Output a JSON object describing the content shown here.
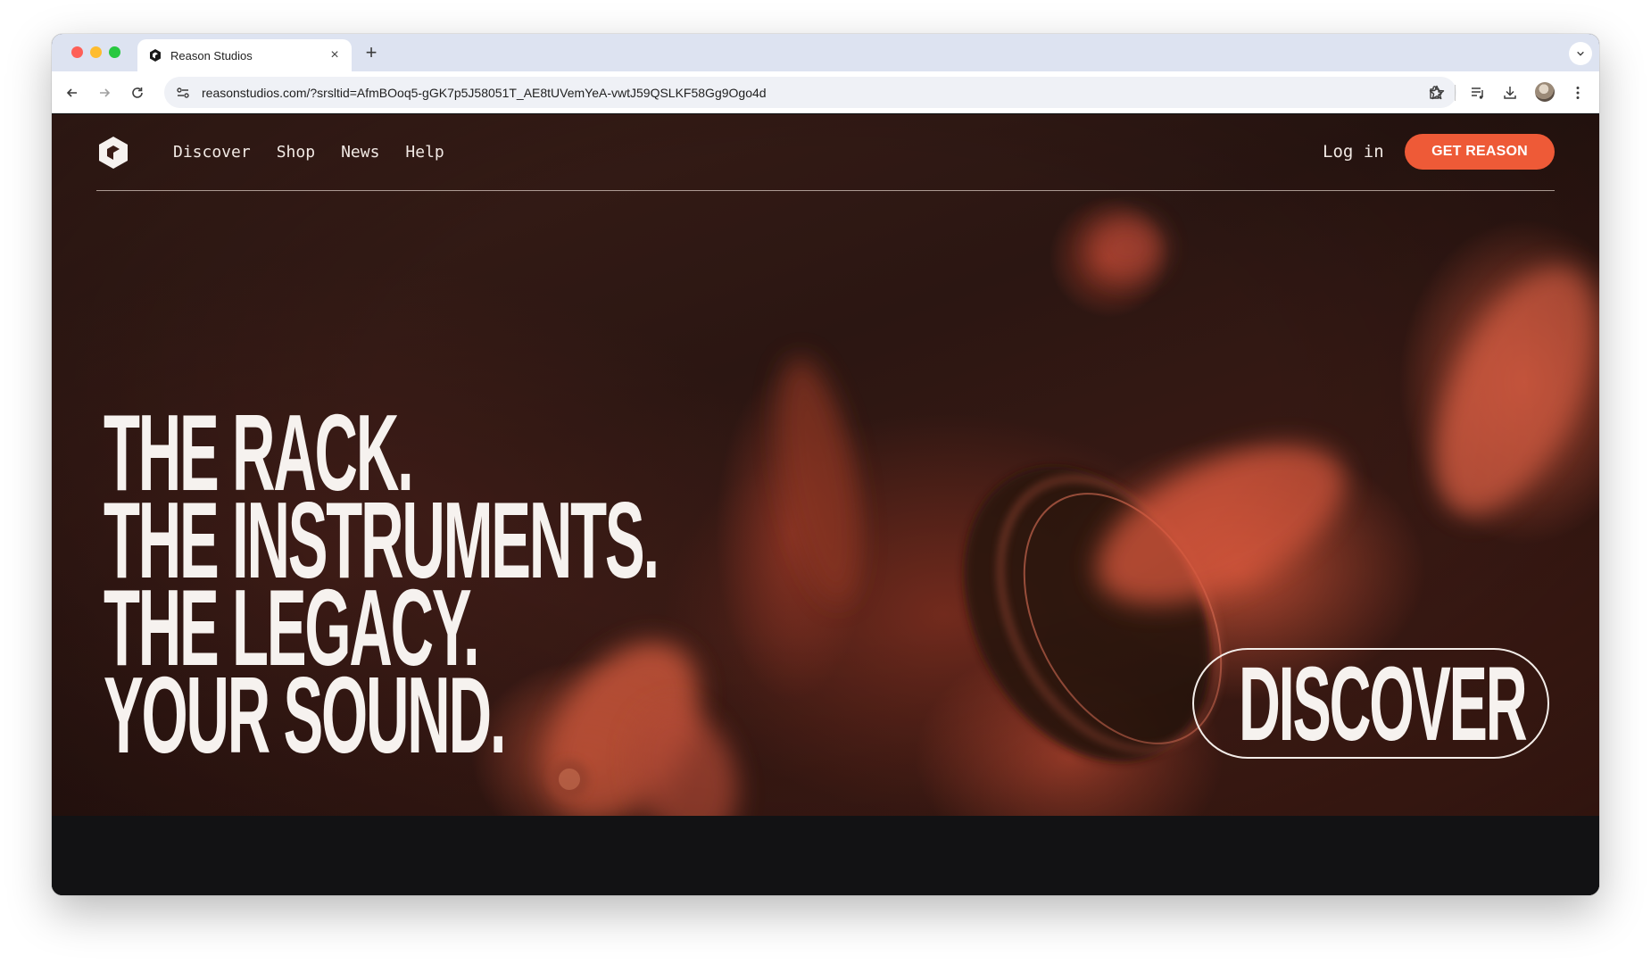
{
  "browser": {
    "tab": {
      "title": "Reason Studios",
      "close_glyph": "×"
    },
    "new_tab_glyph": "+",
    "tab_menu_glyph": "⌄",
    "address_bar": {
      "url": "reasonstudios.com/?srsltid=AfmBOoq5-gGK7p5J58051T_AE8tUVemYeA-vwtJ59QSLKF58Gg9Ogo4d"
    },
    "icons": [
      "back-icon",
      "forward-icon",
      "reload-icon",
      "site-settings-icon",
      "bookmark-star-icon",
      "extensions-icon",
      "media-queue-icon",
      "download-icon",
      "profile-avatar",
      "more-menu-icon"
    ]
  },
  "site": {
    "nav": [
      {
        "label": "Discover"
      },
      {
        "label": "Shop"
      },
      {
        "label": "News"
      },
      {
        "label": "Help"
      }
    ],
    "login_label": "Log in",
    "cta_label": "GET REASON",
    "headline": [
      "THE RACK.",
      "THE INSTRUMENTS.",
      "THE LEGACY.",
      "YOUR SOUND."
    ],
    "discover_label": "DISCOVER"
  },
  "colors": {
    "accent": "#ee5a37",
    "hero_text": "#f6f2ef",
    "page_bg": "#121214",
    "tabstrip_bg": "#dde3f1"
  }
}
